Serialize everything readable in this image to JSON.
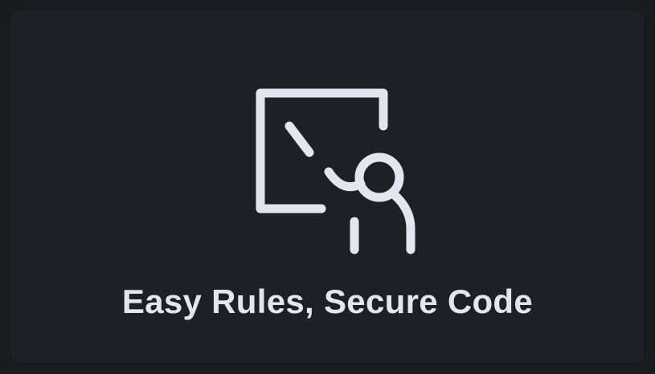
{
  "card": {
    "title": "Easy Rules, Secure Code",
    "icon": "teacher-at-board-icon"
  },
  "colors": {
    "page_background": "#1a1b1f",
    "card_background": "#1f2025",
    "foreground": "#e3e6ee"
  }
}
